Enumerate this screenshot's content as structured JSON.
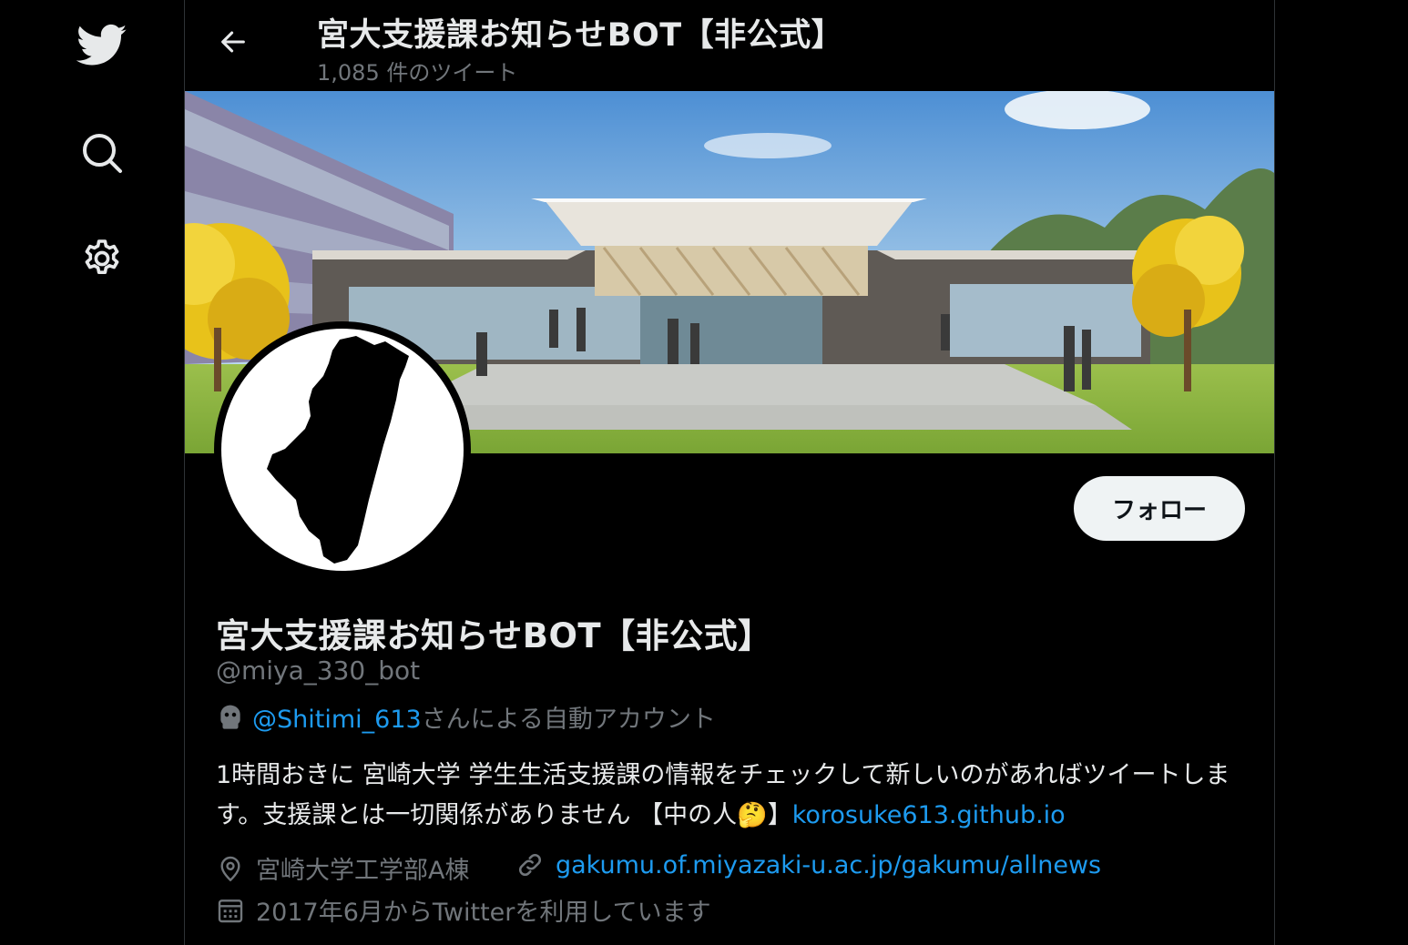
{
  "header": {
    "title": "宮大支援課お知らせBOT【非公式】",
    "tweet_count": "1,085 件のツイート"
  },
  "nav": {
    "icons": [
      "twitter-bird-icon",
      "search-icon",
      "gear-icon"
    ]
  },
  "profile": {
    "name": "宮大支援課お知らせBOT【非公式】",
    "handle": "@miya_330_bot",
    "automated_by_handle": "@Shitimi_613",
    "automated_suffix": "さんによる自動アカウント",
    "bio_text": "1時間おきに 宮崎大学 学生生活支援課の情報をチェックして新しいのがあればツイートします。支援課とは一切関係がありません 【中の人",
    "bio_emoji": "🤔",
    "bio_close": "】",
    "bio_link": "korosuke613.github.io",
    "location": "宮崎大学工学部A棟",
    "website": "gakumu.of.miyazaki-u.ac.jp/gakumu/allnews",
    "joined": "2017年6月からTwitterを利用しています",
    "follow_label": "フォロー"
  },
  "colors": {
    "background": "#000000",
    "text": "#e7e9ea",
    "secondary": "#71767b",
    "link": "#1d9bf0",
    "button_bg": "#eff3f4"
  }
}
